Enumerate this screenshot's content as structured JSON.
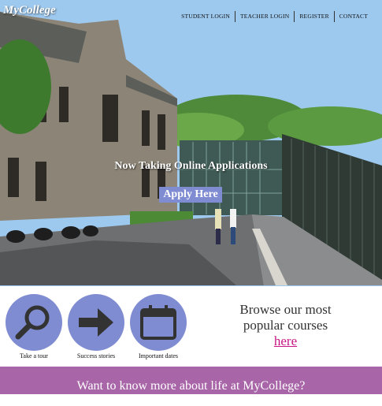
{
  "brand": {
    "logo": "MyCollege"
  },
  "nav": [
    {
      "label": "STUDENT LOGIN"
    },
    {
      "label": "TEACHER LOGIN"
    },
    {
      "label": "REGISTER"
    },
    {
      "label": "CONTACT"
    }
  ],
  "hero": {
    "headline": "Now Taking Online Applications",
    "apply_label": "Apply Here"
  },
  "features": [
    {
      "label": "Take a tour",
      "icon": "search-icon"
    },
    {
      "label": "Success stories",
      "icon": "arrow-right-icon"
    },
    {
      "label": "Important dates",
      "icon": "calendar-icon"
    }
  ],
  "browse": {
    "text": "Browse our most popular courses",
    "link": "here"
  },
  "band": {
    "text": "Want to know more about life at MyCollege?"
  },
  "colors": {
    "accent": "#7f8cd1",
    "band": "#a865a8",
    "link": "#c71585"
  }
}
